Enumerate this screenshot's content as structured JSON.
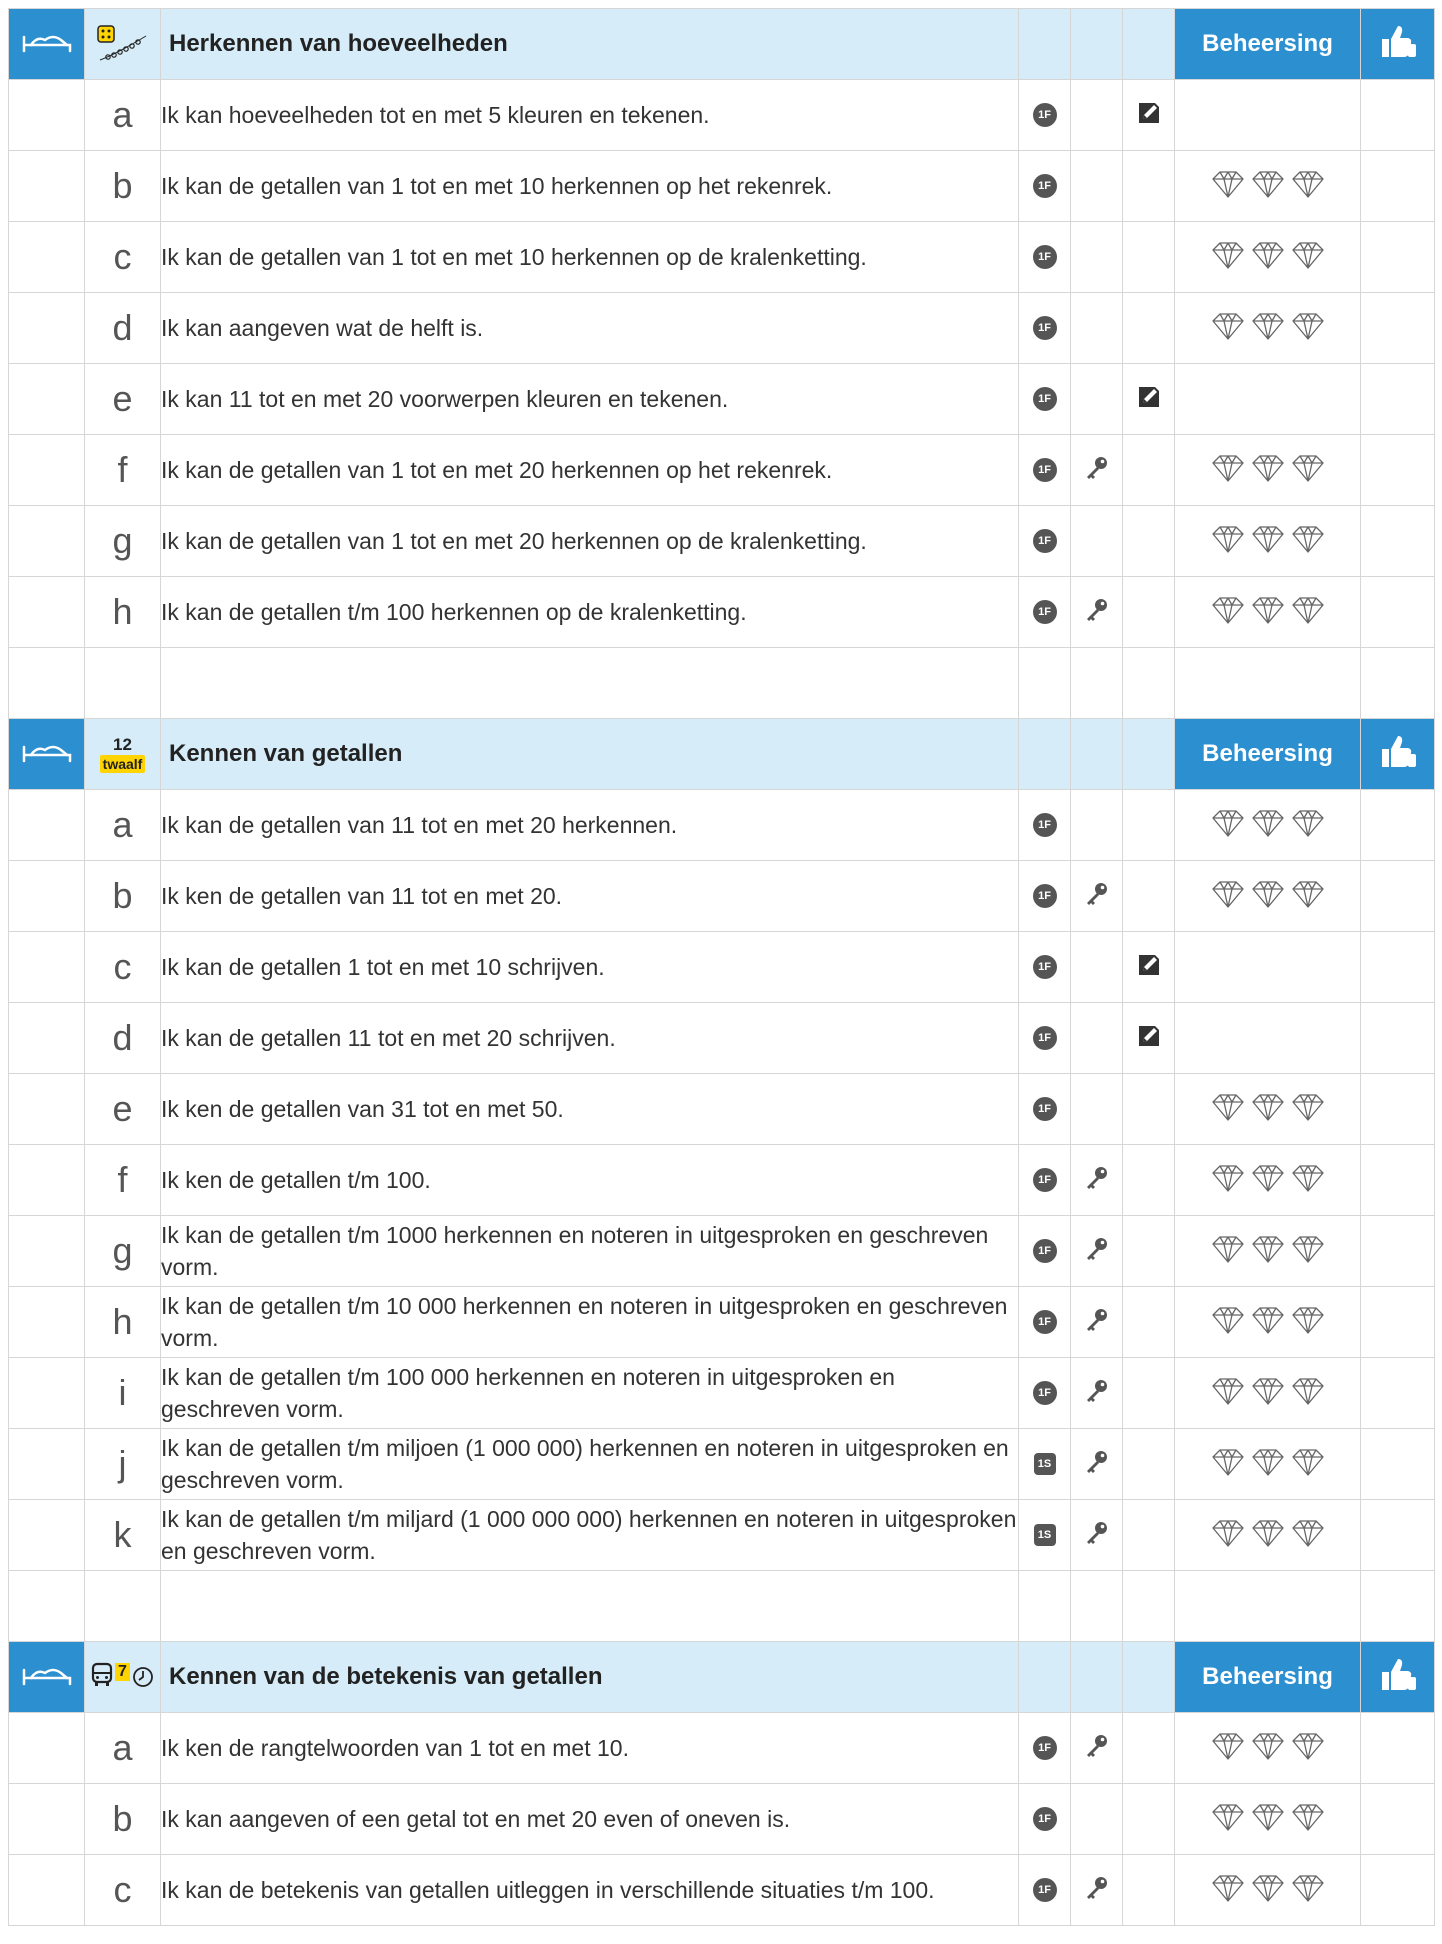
{
  "colors": {
    "header_bg": "#d6ecf8",
    "accent": "#2b8fd0",
    "badge": "#555555",
    "highlight": "#ffd400"
  },
  "sections": [
    {
      "title": "Herkennen van hoeveelheden",
      "topic_icon": "dice-beads-icon",
      "mastery_label": "Beheersing",
      "rows": [
        {
          "letter": "a",
          "text": "Ik kan hoeveelheden tot en met 5 kleuren en tekenen.",
          "level": "1F",
          "key": false,
          "pencil": true,
          "diamonds": false
        },
        {
          "letter": "b",
          "text": "Ik kan de getallen van 1 tot en met 10 herkennen op het rekenrek.",
          "level": "1F",
          "key": false,
          "pencil": false,
          "diamonds": true
        },
        {
          "letter": "c",
          "text": "Ik kan de getallen van 1 tot en met 10 herkennen op de kralenketting.",
          "level": "1F",
          "key": false,
          "pencil": false,
          "diamonds": true
        },
        {
          "letter": "d",
          "text": "Ik kan aangeven wat de helft is.",
          "level": "1F",
          "key": false,
          "pencil": false,
          "diamonds": true
        },
        {
          "letter": "e",
          "text": "Ik kan 11 tot en met 20 voorwerpen kleuren en tekenen.",
          "level": "1F",
          "key": false,
          "pencil": true,
          "diamonds": false
        },
        {
          "letter": "f",
          "text": "Ik kan de getallen van 1 tot en met 20 herkennen op het rekenrek.",
          "level": "1F",
          "key": true,
          "pencil": false,
          "diamonds": true
        },
        {
          "letter": "g",
          "text": "Ik kan de getallen van 1 tot en met 20 herkennen op de kralenketting.",
          "level": "1F",
          "key": false,
          "pencil": false,
          "diamonds": true
        },
        {
          "letter": "h",
          "text": "Ik kan de getallen t/m 100 herkennen op de kralenketting.",
          "level": "1F",
          "key": true,
          "pencil": false,
          "diamonds": true
        }
      ]
    },
    {
      "title": "Kennen van getallen",
      "topic_icon": "number-word-icon",
      "topic_number": "12",
      "topic_word": "twaalf",
      "mastery_label": "Beheersing",
      "rows": [
        {
          "letter": "a",
          "text": "Ik kan de getallen van 11 tot en met 20 herkennen.",
          "level": "1F",
          "key": false,
          "pencil": false,
          "diamonds": true
        },
        {
          "letter": "b",
          "text": "Ik ken de getallen van 11 tot en met 20.",
          "level": "1F",
          "key": true,
          "pencil": false,
          "diamonds": true
        },
        {
          "letter": "c",
          "text": "Ik kan de getallen 1 tot en met 10 schrijven.",
          "level": "1F",
          "key": false,
          "pencil": true,
          "diamonds": false
        },
        {
          "letter": "d",
          "text": "Ik kan de getallen 11 tot en met 20 schrijven.",
          "level": "1F",
          "key": false,
          "pencil": true,
          "diamonds": false
        },
        {
          "letter": "e",
          "text": "Ik ken de getallen van 31 tot en met 50.",
          "level": "1F",
          "key": false,
          "pencil": false,
          "diamonds": true
        },
        {
          "letter": "f",
          "text": "Ik ken de getallen t/m 100.",
          "level": "1F",
          "key": true,
          "pencil": false,
          "diamonds": true
        },
        {
          "letter": "g",
          "text": "Ik kan de getallen t/m 1000 herkennen en noteren in uitgesproken en geschreven vorm.",
          "level": "1F",
          "key": true,
          "pencil": false,
          "diamonds": true
        },
        {
          "letter": "h",
          "text": "Ik kan de getallen t/m 10 000 herkennen en noteren in uitgesproken en geschreven vorm.",
          "level": "1F",
          "key": true,
          "pencil": false,
          "diamonds": true
        },
        {
          "letter": "i",
          "text": "Ik kan de getallen t/m 100 000 herkennen en noteren in uitgesproken en geschreven vorm.",
          "level": "1F",
          "key": true,
          "pencil": false,
          "diamonds": true
        },
        {
          "letter": "j",
          "text": "Ik kan de getallen t/m miljoen (1 000 000) herkennen en noteren in uitgesproken en geschreven vorm.",
          "level": "1S",
          "key": true,
          "pencil": false,
          "diamonds": true
        },
        {
          "letter": "k",
          "text": "Ik kan de getallen t/m miljard (1 000 000 000) herkennen en noteren in uitgesproken en geschreven vorm.",
          "level": "1S",
          "key": true,
          "pencil": false,
          "diamonds": true
        }
      ]
    },
    {
      "title": "Kennen van de betekenis van getallen",
      "topic_icon": "bus-seven-clock-icon",
      "topic_number": "7",
      "mastery_label": "Beheersing",
      "rows": [
        {
          "letter": "a",
          "text": "Ik ken de rangtelwoorden van 1 tot en met 10.",
          "level": "1F",
          "key": true,
          "pencil": false,
          "diamonds": true
        },
        {
          "letter": "b",
          "text": "Ik kan aangeven of een getal tot en met 20 even of oneven is.",
          "level": "1F",
          "key": false,
          "pencil": false,
          "diamonds": true
        },
        {
          "letter": "c",
          "text": "Ik kan de betekenis van getallen uitleggen in verschillende situaties t/m 100.",
          "level": "1F",
          "key": true,
          "pencil": false,
          "diamonds": true
        }
      ]
    }
  ]
}
